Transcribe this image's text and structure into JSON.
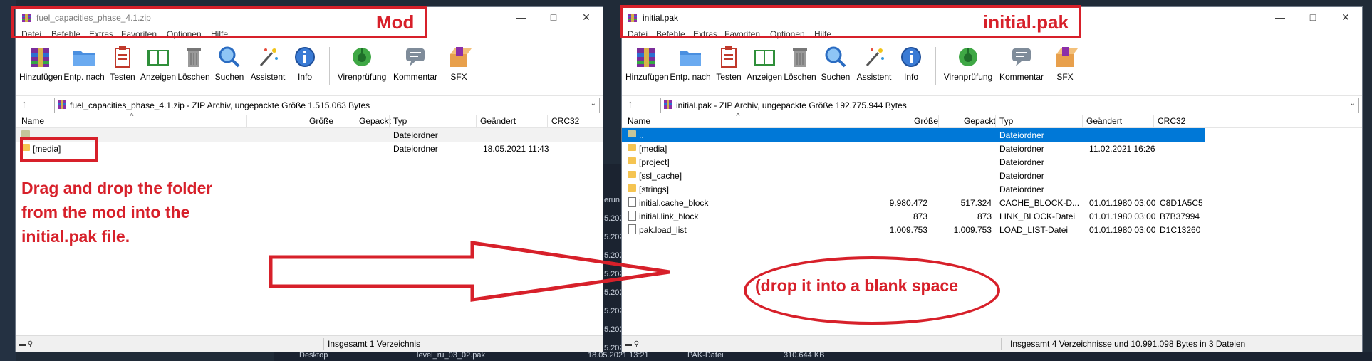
{
  "desktop": {
    "side_labels": [
      "erun",
      "5.202",
      "5.202",
      "5.202",
      "5.202",
      "5.202",
      "5.202",
      "5.202",
      "5.202"
    ],
    "taskbar": {
      "item1": "Desktop",
      "file_name": "level_ru_03_02.pak",
      "file_date": "18.05.2021 13:21",
      "file_type": "PAK-Datei",
      "file_size": "310.644 KB"
    }
  },
  "left_window": {
    "title": "fuel_capacities_phase_4.1.zip",
    "menu": [
      "Datei",
      "Befehle",
      "Extras",
      "Favoriten",
      "Optionen",
      "Hilfe"
    ],
    "toolbar": [
      "Hinzufügen",
      "Entp. nach",
      "Testen",
      "Anzeigen",
      "Löschen",
      "Suchen",
      "Assistent",
      "Info",
      "Virenprüfung",
      "Kommentar",
      "SFX"
    ],
    "address": "fuel_capacities_phase_4.1.zip - ZIP Archiv, ungepackte Größe 1.515.063 Bytes",
    "columns": [
      "Name",
      "Größe",
      "Gepackt",
      "Typ",
      "Geändert",
      "CRC32"
    ],
    "rows": [
      {
        "name": "..",
        "size": "",
        "packed": "",
        "type": "Dateiordner",
        "modified": "",
        "crc": ""
      },
      {
        "name": "[media]",
        "size": "",
        "packed": "",
        "type": "Dateiordner",
        "modified": "18.05.2021 11:43",
        "crc": ""
      }
    ],
    "status": "Insgesamt 1 Verzeichnis"
  },
  "right_window": {
    "title": "initial.pak",
    "menu": [
      "Datei",
      "Befehle",
      "Extras",
      "Favoriten",
      "Optionen",
      "Hilfe"
    ],
    "toolbar": [
      "Hinzufügen",
      "Entp. nach",
      "Testen",
      "Anzeigen",
      "Löschen",
      "Suchen",
      "Assistent",
      "Info",
      "Virenprüfung",
      "Kommentar",
      "SFX"
    ],
    "address": "initial.pak - ZIP Archiv, ungepackte Größe 192.775.944 Bytes",
    "columns": [
      "Name",
      "Größe",
      "Gepackt",
      "Typ",
      "Geändert",
      "CRC32"
    ],
    "rows": [
      {
        "name": "..",
        "size": "",
        "packed": "",
        "type": "Dateiordner",
        "modified": "",
        "crc": ""
      },
      {
        "name": "[media]",
        "size": "",
        "packed": "",
        "type": "Dateiordner",
        "modified": "11.02.2021 16:26",
        "crc": ""
      },
      {
        "name": "[project]",
        "size": "",
        "packed": "",
        "type": "Dateiordner",
        "modified": "",
        "crc": ""
      },
      {
        "name": "[ssl_cache]",
        "size": "",
        "packed": "",
        "type": "Dateiordner",
        "modified": "",
        "crc": ""
      },
      {
        "name": "[strings]",
        "size": "",
        "packed": "",
        "type": "Dateiordner",
        "modified": "",
        "crc": ""
      },
      {
        "name": "initial.cache_block",
        "size": "9.980.472",
        "packed": "517.324",
        "type": "CACHE_BLOCK-D...",
        "modified": "01.01.1980 03:00",
        "crc": "C8D1A5C5"
      },
      {
        "name": "initial.link_block",
        "size": "873",
        "packed": "873",
        "type": "LINK_BLOCK-Datei",
        "modified": "01.01.1980 03:00",
        "crc": "B7B37994"
      },
      {
        "name": "pak.load_list",
        "size": "1.009.753",
        "packed": "1.009.753",
        "type": "LOAD_LIST-Datei",
        "modified": "01.01.1980 03:00",
        "crc": "D1C13260"
      }
    ],
    "status": "Insgesamt 4 Verzeichnisse und 10.991.098 Bytes in 3 Dateien"
  },
  "annotations": {
    "mod_label": "Mod",
    "pak_label": "initial.pak",
    "instruction_lines": [
      "Drag and drop the folder",
      "from the mod into the",
      "initial.pak file."
    ],
    "drop_hint": "(drop it into a blank space",
    "color": "#d7202a"
  }
}
